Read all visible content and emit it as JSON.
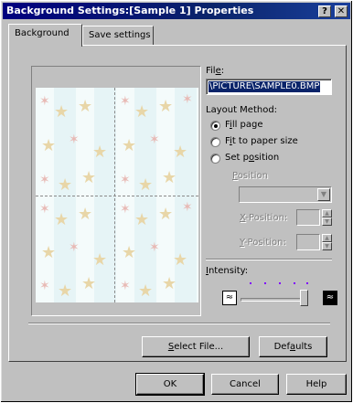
{
  "window": {
    "title": "Background Settings:[Sample 1] Properties",
    "help_btn": "?",
    "close_btn": "✕"
  },
  "tabs": [
    {
      "label": "Background",
      "active": true
    },
    {
      "label": "Save settings",
      "active": false
    }
  ],
  "file": {
    "label_pre": "Fil",
    "label_u": "e",
    "label_post": ":",
    "value": "\\PICTURE\\SAMPLE0.BMP"
  },
  "layout": {
    "title": "Layout Method:",
    "options": [
      {
        "pre": "F",
        "u": "i",
        "post": "ll page",
        "checked": true
      },
      {
        "pre": "F",
        "u": "i",
        "post": "t to paper size",
        "checked": false
      },
      {
        "pre": "Set p",
        "u": "o",
        "post": "sition",
        "checked": false
      }
    ]
  },
  "position": {
    "label_u": "P",
    "label_post": "osition",
    "x_label_u": "X",
    "x_label_post": "-Position:",
    "y_label_u": "Y",
    "y_label_post": "-Position:"
  },
  "intensity": {
    "label_u": "I",
    "label_post": "ntensity:",
    "value": 1.0
  },
  "panel_buttons": {
    "select_file_u": "S",
    "select_file_post": "elect File...",
    "defaults_pre": "Def",
    "defaults_u": "a",
    "defaults_post": "ults"
  },
  "dialog_buttons": {
    "ok": "OK",
    "cancel": "Cancel",
    "help": "Help"
  },
  "icons": {
    "title_help": "question-icon",
    "title_close": "close-icon",
    "intensity_low": "low-intensity-icon",
    "intensity_high": "high-intensity-icon",
    "preview": "starfish-pattern"
  },
  "colors": {
    "titlebar": "#0a246a",
    "selection": "#0a246a",
    "face": "#c0c0c0",
    "slider_ticks": "#8000ff"
  }
}
